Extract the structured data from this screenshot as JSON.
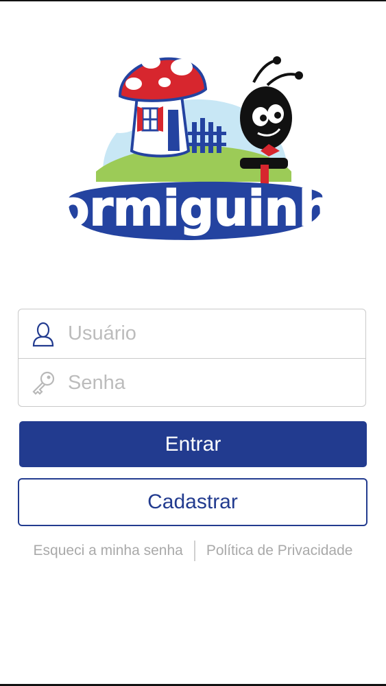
{
  "app": {
    "brand_name": "Formiguinha"
  },
  "login": {
    "username_placeholder": "Usuário",
    "username_value": "",
    "password_placeholder": "Senha",
    "password_value": ""
  },
  "actions": {
    "primary_label": "Entrar",
    "secondary_label": "Cadastrar"
  },
  "footer_links": {
    "forgot_password": "Esqueci a minha senha",
    "privacy_policy": "Política de Privacidade"
  },
  "colors": {
    "primary": "#223b8f",
    "placeholder": "#bcbcbc",
    "link": "#a9a9a9",
    "border": "#c9c9c9"
  },
  "icons": {
    "username": "user-icon",
    "password": "key-icon"
  }
}
